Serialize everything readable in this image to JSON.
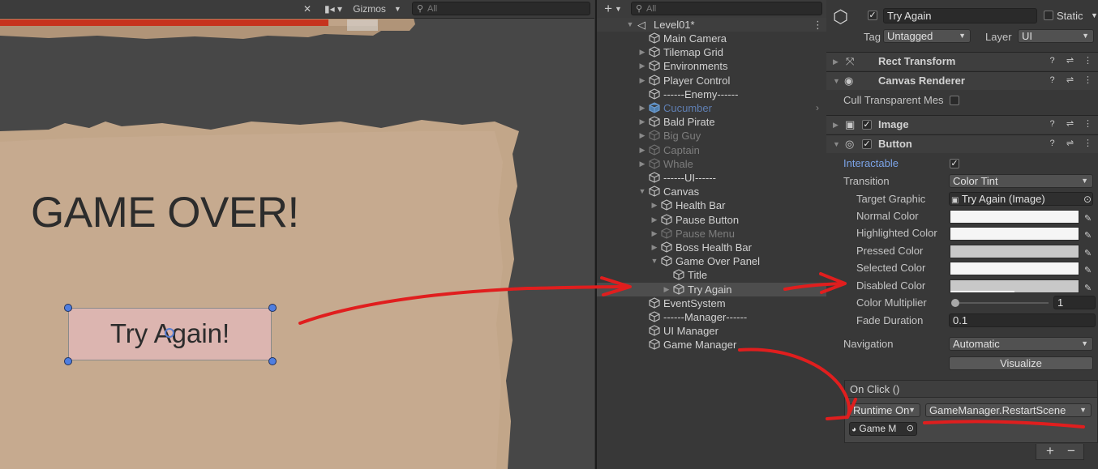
{
  "scene": {
    "toolbar": {
      "gizmos_label": "Gizmos",
      "search_placeholder": "All"
    },
    "game_over_title": "GAME OVER!",
    "try_again_label": "Try Again!"
  },
  "hierarchy": {
    "search_placeholder": "All",
    "add_label": "+",
    "scene_name": "Level01*",
    "items": [
      {
        "label": "Main Camera"
      },
      {
        "label": "Tilemap Grid"
      },
      {
        "label": "Environments"
      },
      {
        "label": "Player Control"
      },
      {
        "label": "------Enemy------"
      },
      {
        "label": "Cucumber"
      },
      {
        "label": "Bald Pirate"
      },
      {
        "label": "Big Guy"
      },
      {
        "label": "Captain"
      },
      {
        "label": "Whale"
      },
      {
        "label": "------UI------"
      },
      {
        "label": "Canvas"
      },
      {
        "label": "Health Bar"
      },
      {
        "label": "Pause Button"
      },
      {
        "label": "Pause Menu"
      },
      {
        "label": "Boss Health Bar"
      },
      {
        "label": "Game Over Panel"
      },
      {
        "label": "Title"
      },
      {
        "label": "Try Again"
      },
      {
        "label": "EventSystem"
      },
      {
        "label": "------Manager------"
      },
      {
        "label": "UI Manager"
      },
      {
        "label": "Game Manager"
      }
    ]
  },
  "inspector": {
    "object_name": "Try Again",
    "static_label": "Static",
    "tag_label": "Tag",
    "tag_value": "Untagged",
    "layer_label": "Layer",
    "layer_value": "UI",
    "rect_transform": "Rect Transform",
    "canvas_renderer": "Canvas Renderer",
    "cull_label": "Cull Transparent Mes",
    "image": "Image",
    "button": "Button",
    "interactable_label": "Interactable",
    "transition_label": "Transition",
    "transition_value": "Color Tint",
    "target_graphic_label": "Target Graphic",
    "target_graphic_value": "Try Again (Image)",
    "normal_color_label": "Normal Color",
    "highlighted_color_label": "Highlighted Color",
    "pressed_color_label": "Pressed Color",
    "selected_color_label": "Selected Color",
    "disabled_color_label": "Disabled Color",
    "color_multiplier_label": "Color Multiplier",
    "color_multiplier_value": "1",
    "color_multiplier_fraction": 0,
    "fade_duration_label": "Fade Duration",
    "fade_duration_value": "0.1",
    "navigation_label": "Navigation",
    "navigation_value": "Automatic",
    "visualize_label": "Visualize",
    "onclick_label": "On Click ()",
    "runtime_value": "Runtime On",
    "function_value": "GameManager.RestartScene",
    "object_value": "Game M",
    "add_event": "+",
    "remove_event": "−"
  },
  "colors": {
    "normal": "#f5f5f5",
    "highlighted": "#f5f5f5",
    "pressed": "#c8c8c8",
    "selected": "#f5f5f5",
    "disabled": "#c8c8c8",
    "accent": "#7ba3e6",
    "annotation": "#e01e1e"
  }
}
